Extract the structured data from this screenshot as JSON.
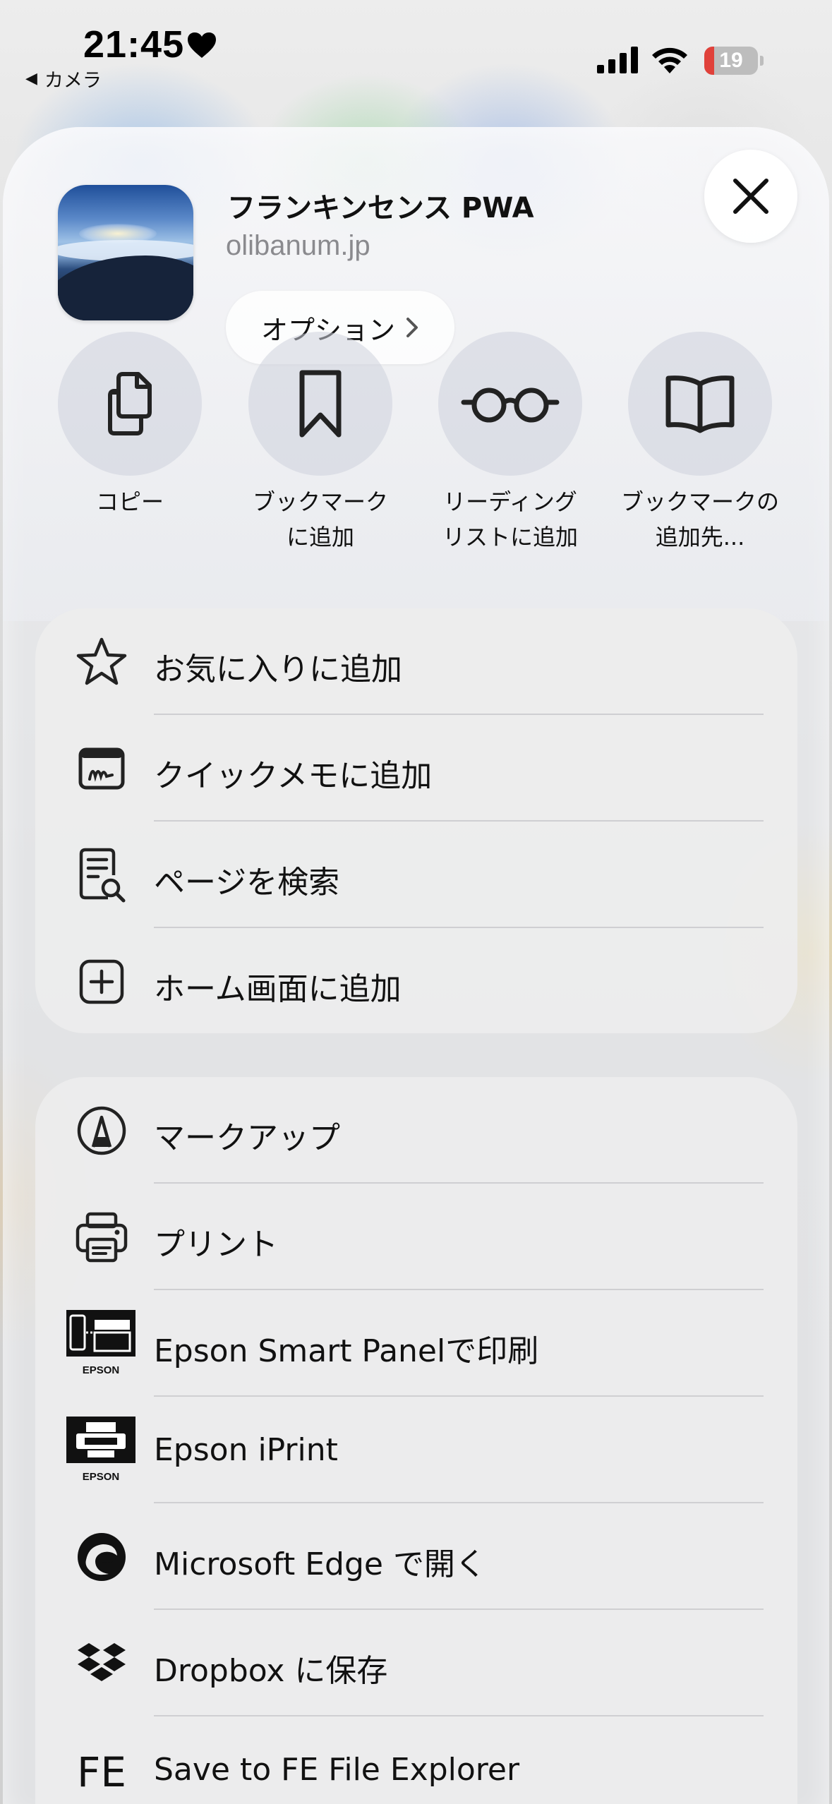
{
  "status_bar": {
    "time": "21:45",
    "back_label": "カメラ",
    "battery_level": "19",
    "battery_fraction": 0.19,
    "icons": [
      "heart-icon",
      "signal-icon",
      "wifi-icon",
      "battery-icon"
    ]
  },
  "header": {
    "app_title": "フランキンセンス PWA",
    "url": "olibanum.jp",
    "options_label": "オプション"
  },
  "actions": [
    {
      "label": "コピー",
      "icon": "copy-icon"
    },
    {
      "label": "ブックマーク\nに追加",
      "icon": "bookmark-icon"
    },
    {
      "label": "リーディング\nリストに追加",
      "icon": "glasses-icon"
    },
    {
      "label": "ブックマークの\n追加先...",
      "icon": "book-icon"
    }
  ],
  "menu_group1": [
    {
      "label": "お気に入りに追加",
      "icon": "star-icon"
    },
    {
      "label": "クイックメモに追加",
      "icon": "quick-note-icon"
    },
    {
      "label": "ページを検索",
      "icon": "find-on-page-icon"
    },
    {
      "label": "ホーム画面に追加",
      "icon": "add-square-icon"
    }
  ],
  "menu_group2": [
    {
      "label": "マークアップ",
      "icon": "markup-icon"
    },
    {
      "label": "プリント",
      "icon": "printer-icon"
    },
    {
      "label": "Epson Smart Panelで印刷",
      "icon": "epson-smart-panel-icon",
      "icon_caption": "EPSON"
    },
    {
      "label": "Epson iPrint",
      "icon": "epson-iprint-icon",
      "icon_caption": "EPSON"
    },
    {
      "label": "Microsoft Edge で開く",
      "icon": "edge-icon"
    },
    {
      "label": "Dropbox に保存",
      "icon": "dropbox-icon"
    },
    {
      "label": "Save to FE File Explorer",
      "icon": "fe-file-explorer-icon",
      "icon_text": "FE"
    }
  ]
}
